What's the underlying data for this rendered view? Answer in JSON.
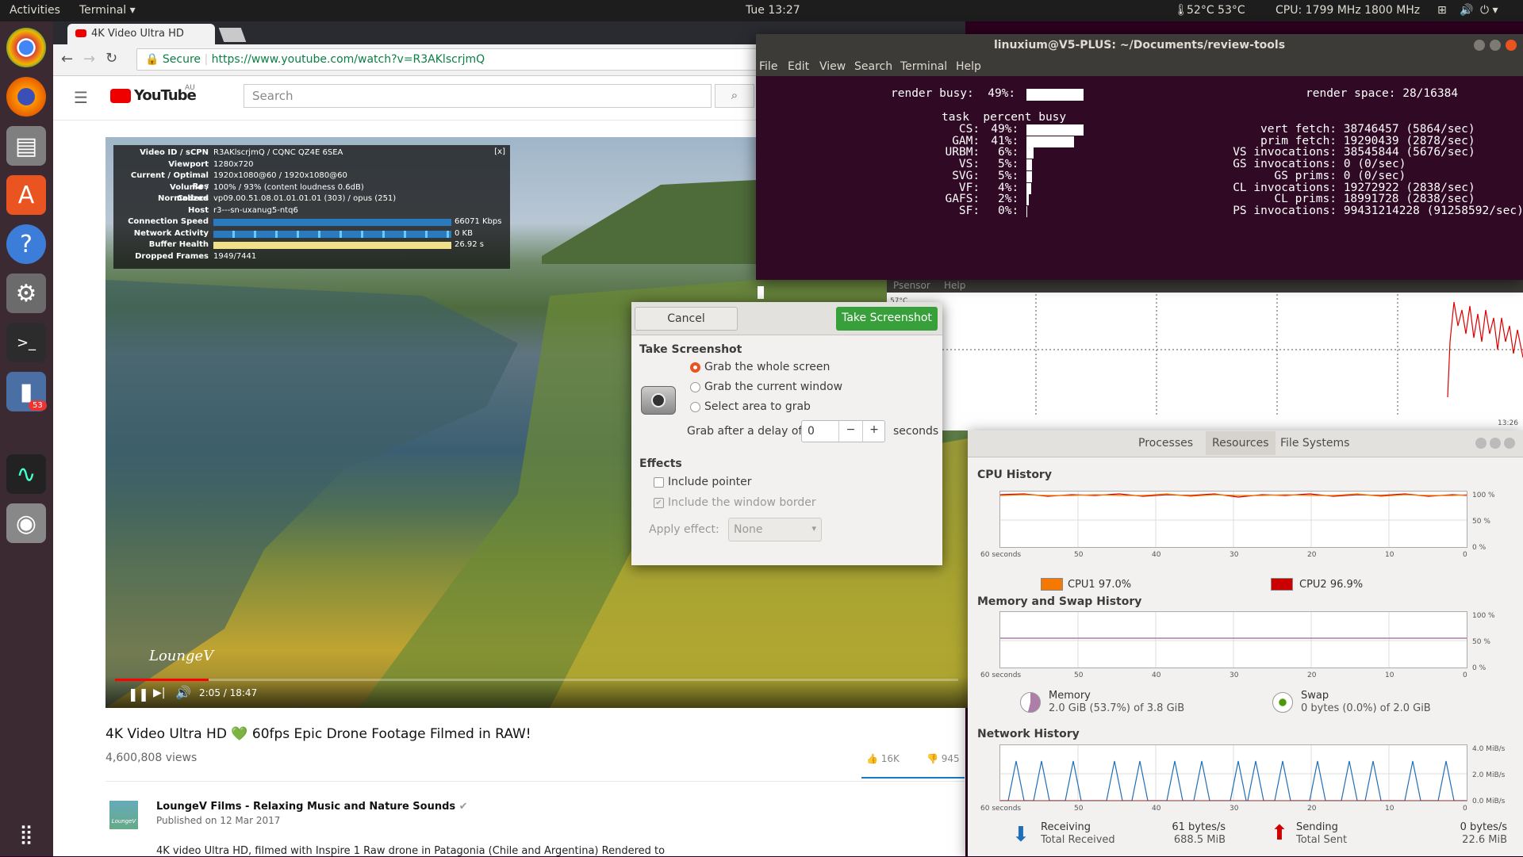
{
  "topbar": {
    "activities": "Activities",
    "app_menu": "Terminal",
    "clock": "Tue 13:27",
    "temps": "52°C 53°C",
    "cpu_freq": "CPU: 1799 MHz 1800 MHz"
  },
  "launcher": {
    "badge_count": "53",
    "icons": [
      "chrome-icon",
      "firefox-icon",
      "files-icon",
      "software-center-icon",
      "help-icon",
      "settings-icon",
      "terminal-icon",
      "app-icon",
      "system-monitor-icon",
      "screenshot-icon",
      "app-grid-icon"
    ]
  },
  "browser": {
    "tab_title": "4K Video Ultra HD",
    "secure_label": "Secure",
    "url": "https://www.youtube.com/watch?v=R3AKlscrjmQ",
    "yt_logo": "YouTube",
    "yt_region": "AU",
    "search_placeholder": "Search",
    "stats": [
      {
        "k": "Video ID / sCPN",
        "v": "R3AKlscrjmQ / CQNC QZ4E 6SEA"
      },
      {
        "k": "Viewport",
        "v": "1280x720"
      },
      {
        "k": "Current / Optimal Res",
        "v": "1920x1080@60 / 1920x1080@60"
      },
      {
        "k": "Volume / Normalized",
        "v": "100% / 93% (content loudness 0.6dB)"
      },
      {
        "k": "Codecs",
        "v": "vp09.00.51.08.01.01.01.01 (303) / opus (251)"
      },
      {
        "k": "Host",
        "v": "r3---sn-uxanug5-ntq6"
      }
    ],
    "stats_close": "[x]",
    "conn_label": "Connection Speed",
    "conn_value": "66071 Kbps",
    "net_label": "Network Activity",
    "net_value": "0 KB",
    "buffer_label": "Buffer Health",
    "buffer_value": "26.92 s",
    "dropped_label": "Dropped Frames",
    "dropped_value": "1949/7441",
    "watermark": "LoungeV",
    "time": "2:05 / 18:47",
    "progress_fraction": 0.111,
    "video_title": "4K Video Ultra HD 💚 60fps Epic Drone Footage Filmed in RAW!",
    "views": "4,600,808 views",
    "likes": "16K",
    "dislikes": "945",
    "channel": "LoungeV Films - Relaxing Music and Nature Sounds",
    "published": "Published on 12 Mar 2017",
    "description": "4K video Ultra HD, filmed with Inspire 1 Raw drone in Patagonia (Chile and Argentina) Rendered to",
    "channel_avatar_text": "LoungeV"
  },
  "terminal": {
    "title": "linuxium@V5-PLUS: ~/Documents/review-tools",
    "menu": [
      "File",
      "Edit",
      "View",
      "Search",
      "Terminal",
      "Help"
    ],
    "render_busy": "render busy:  49%:",
    "render_space": "render space: 28/16384",
    "header": "task  percent busy",
    "tasks": [
      {
        "name": "CS:",
        "pct": "49%:",
        "frac": 0.49
      },
      {
        "name": "GAM:",
        "pct": "41%:",
        "frac": 0.41
      },
      {
        "name": "URBM:",
        "pct": "6%:",
        "frac": 0.06
      },
      {
        "name": "VS:",
        "pct": "5%:",
        "frac": 0.05
      },
      {
        "name": "SVG:",
        "pct": "5%:",
        "frac": 0.05
      },
      {
        "name": "VF:",
        "pct": "4%:",
        "frac": 0.04
      },
      {
        "name": "GAFS:",
        "pct": "2%:",
        "frac": 0.02
      },
      {
        "name": "SF:",
        "pct": "0%:",
        "frac": 0.0
      }
    ],
    "stats": [
      "vert fetch: 38746457 (5864/sec)",
      "prim fetch: 19290439 (2878/sec)",
      "VS invocations: 38545844 (5676/sec)",
      "GS invocations: 0 (0/sec)",
      "GS prims: 0 (0/sec)",
      "CL invocations: 19272922 (2838/sec)",
      "CL prims: 18991728 (2838/sec)",
      "PS invocations: 99431214228 (91258592/sec)"
    ]
  },
  "psensor": {
    "menu": [
      "Psensor",
      "Help"
    ],
    "temp_label": "57°C",
    "time_label": "13:26"
  },
  "dialog": {
    "cancel": "Cancel",
    "take": "Take Screenshot",
    "section": "Take Screenshot",
    "options": [
      "Grab the whole screen",
      "Grab the current window",
      "Select area to grab"
    ],
    "delay_label": "Grab after a delay of",
    "delay_value": "0",
    "delay_unit": "seconds",
    "effects": "Effects",
    "include_pointer": "Include pointer",
    "include_border": "Include the window border",
    "apply_effect": "Apply effect:",
    "effect_value": "None"
  },
  "sysmon": {
    "tabs": [
      "Processes",
      "Resources",
      "File Systems"
    ],
    "cpu_title": "CPU History",
    "cpu1_label": "CPU1",
    "cpu1_value": "97.0%",
    "cpu1_color": "#f57900",
    "cpu2_label": "CPU2",
    "cpu2_value": "96.9%",
    "cpu2_color": "#cc0000",
    "mem_title": "Memory and Swap History",
    "mem_label": "Memory",
    "mem_value": "2.0 GiB (53.7%) of 3.8 GiB",
    "swap_label": "Swap",
    "swap_value": "0 bytes (0.0%) of 2.0 GiB",
    "net_title": "Network History",
    "recv_label": "Receiving",
    "recv_total_label": "Total Received",
    "recv_rate": "61 bytes/s",
    "recv_total": "688.5 MiB",
    "send_label": "Sending",
    "send_total_label": "Total Sent",
    "send_rate": "0 bytes/s",
    "send_total": "22.6 MiB",
    "x_ticks": [
      "60 seconds",
      "50",
      "40",
      "30",
      "20",
      "10",
      "0"
    ],
    "pct_ticks": [
      "100 %",
      "50 %",
      "0 %"
    ],
    "net_ticks": [
      "4.0 MiB/s",
      "2.0 MiB/s",
      "0.0 MiB/s"
    ]
  }
}
